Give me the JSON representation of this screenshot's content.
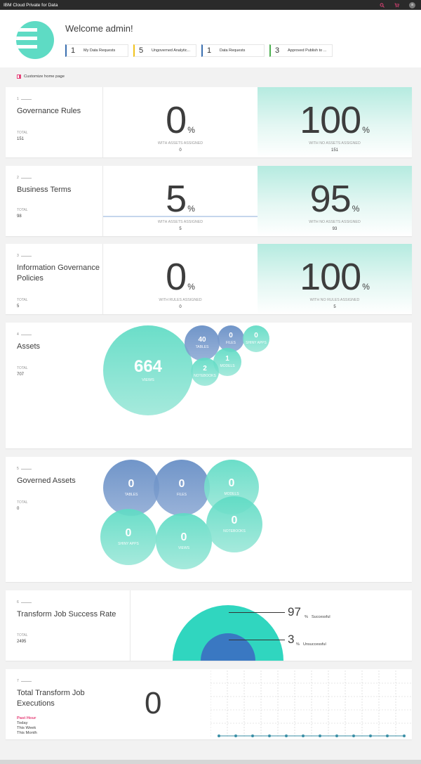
{
  "app": {
    "title": "IBM Cloud Private for Data",
    "avatar_initial": "a"
  },
  "welcome": {
    "title": "Welcome admin!"
  },
  "requests": [
    {
      "count": "1",
      "label": "My Data Requests",
      "color": "#3a6fb0"
    },
    {
      "count": "5",
      "label": "Ungoverned Analytic...",
      "color": "#f1c21b"
    },
    {
      "count": "1",
      "label": "Data Requests",
      "color": "#3a6fb0"
    },
    {
      "count": "3",
      "label": "Approved Publish to ...",
      "color": "#4caf50"
    }
  ],
  "customize_label": "Customize home page",
  "cards": {
    "governance_rules": {
      "index": "1",
      "title": "Governance Rules",
      "total_label": "TOTAL",
      "total": "151",
      "left_pct": "0",
      "left_label": "WITH ASSETS ASSIGNED",
      "left_count": "0",
      "right_pct": "100",
      "right_label": "WITH NO ASSETS ASSIGNED",
      "right_count": "151",
      "pct_sign": "%"
    },
    "business_terms": {
      "index": "2",
      "title": "Business Terms",
      "total_label": "TOTAL",
      "total": "98",
      "left_pct": "5",
      "left_label": "WITH ASSETS ASSIGNED",
      "left_count": "5",
      "right_pct": "95",
      "right_label": "WITH NO ASSETS ASSIGNED",
      "right_count": "93",
      "pct_sign": "%"
    },
    "policies": {
      "index": "3",
      "title": "Information Governance Policies",
      "total_label": "TOTAL",
      "total": "5",
      "left_pct": "0",
      "left_label": "WITH RULES ASSIGNED",
      "left_count": "0",
      "right_pct": "100",
      "right_label": "WITH NO RULES ASSIGNED",
      "right_count": "5",
      "pct_sign": "%"
    },
    "assets": {
      "index": "4",
      "title": "Assets",
      "total_label": "TOTAL",
      "total": "707",
      "bubbles": [
        {
          "value": "664",
          "label": "VIEWS"
        },
        {
          "value": "40",
          "label": "TABLES"
        },
        {
          "value": "0",
          "label": "FILES"
        },
        {
          "value": "0",
          "label": "SHINY APPS"
        },
        {
          "value": "1",
          "label": "MODELS"
        },
        {
          "value": "2",
          "label": "NOTEBOOKS"
        }
      ]
    },
    "governed_assets": {
      "index": "5",
      "title": "Governed Assets",
      "total_label": "TOTAL",
      "total": "0",
      "bubbles": [
        {
          "value": "0",
          "label": "TABLES"
        },
        {
          "value": "0",
          "label": "FILES"
        },
        {
          "value": "0",
          "label": "MODELS"
        },
        {
          "value": "0",
          "label": "SHINY APPS"
        },
        {
          "value": "0",
          "label": "VIEWS"
        },
        {
          "value": "0",
          "label": "NOTEBOOKS"
        }
      ]
    },
    "transform_success": {
      "index": "6",
      "title": "Transform Job Success Rate",
      "total_label": "TOTAL",
      "total": "2495",
      "successful_pct": "97",
      "successful_label": "Successful",
      "unsuccessful_pct": "3",
      "unsuccessful_label": "Unsuccessful",
      "pct_sign": "%"
    },
    "transform_exec": {
      "index": "7",
      "title": "Total Transform Job Executions",
      "value": "0",
      "periods": [
        "Past Hour",
        "Today",
        "This Week",
        "This Month"
      ],
      "active_period": "Past Hour"
    }
  },
  "colors": {
    "accent": "#e6437a",
    "teal": "#5edbc4",
    "blue": "#3a6fb0"
  }
}
